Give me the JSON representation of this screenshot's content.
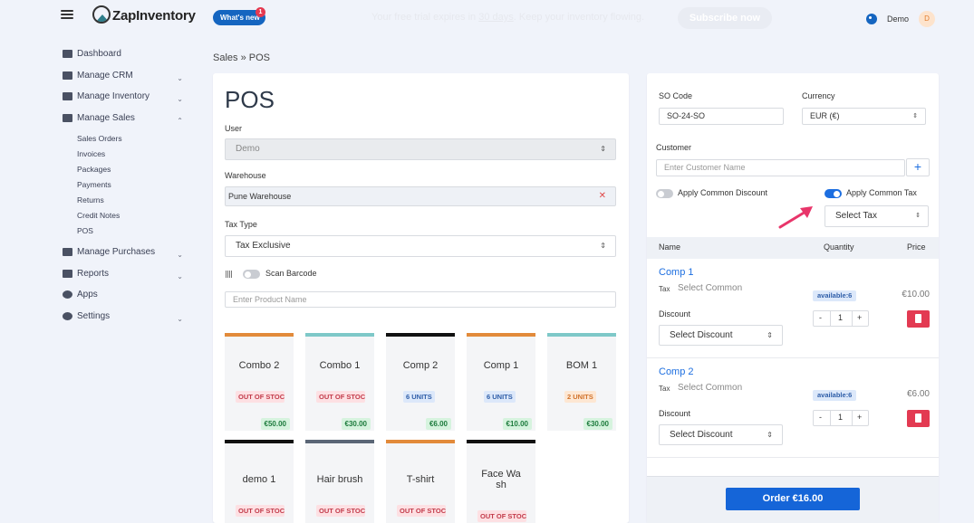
{
  "header": {
    "app_name": "ZapInventory",
    "whats_new": "What's new",
    "whats_new_count": "1",
    "promo_text": "Your free trial expires in",
    "promo_link": "30 days",
    "promo_suffix": ". Keep your inventory flowing.",
    "subscribe_label": "Subscribe now",
    "user_name": "Demo",
    "user_initial": "D"
  },
  "sidebar": {
    "items": [
      {
        "label": "Dashboard",
        "icon": "home-icon"
      },
      {
        "label": "Manage CRM",
        "icon": "users-icon"
      },
      {
        "label": "Manage Inventory",
        "icon": "inventory-icon"
      },
      {
        "label": "Manage Sales",
        "icon": "cart-icon"
      }
    ],
    "sales_sub": [
      "Sales Orders",
      "Invoices",
      "Packages",
      "Payments",
      "Returns",
      "Credit Notes",
      "POS"
    ],
    "items_after": [
      {
        "label": "Manage Purchases",
        "icon": "purchases-icon"
      },
      {
        "label": "Reports",
        "icon": "reports-icon"
      },
      {
        "label": "Apps",
        "icon": "apps-icon"
      },
      {
        "label": "Settings",
        "icon": "gear-icon"
      }
    ]
  },
  "breadcrumb": {
    "parent": "Sales",
    "sep": "»",
    "current": "POS"
  },
  "pos": {
    "title": "POS",
    "user_label": "User",
    "user_value": "Demo",
    "warehouse_label": "Warehouse",
    "warehouse_value": "Pune Warehouse",
    "tax_type_label": "Tax Type",
    "tax_type_value": "Tax Exclusive",
    "scan_label": "Scan Barcode",
    "product_placeholder": "Enter Product Name",
    "products": [
      {
        "name": "Combo 2",
        "stock": "OUT OF STOCK",
        "price": "€50.00",
        "color": "#e28a3a"
      },
      {
        "name": "Combo 1",
        "stock": "OUT OF STOCK",
        "price": "€30.00",
        "color": "#7ec8c8"
      },
      {
        "name": "Comp 2",
        "stock": "6 UNITS",
        "price": "€6.00",
        "color": "#111111"
      },
      {
        "name": "Comp 1",
        "stock": "6 UNITS",
        "price": "€10.00",
        "color": "#e28a3a"
      },
      {
        "name": "BOM 1",
        "stock": "2 UNITS",
        "price": "€30.00",
        "color": "#7ec8c8"
      },
      {
        "name": "demo 1",
        "stock": "OUT OF STOCK",
        "color": "#111111"
      },
      {
        "name": "Hair brush",
        "stock": "OUT OF STOCK",
        "color": "#5a6676"
      },
      {
        "name": "T-shirt",
        "stock": "OUT OF STOCK",
        "color": "#e28a3a"
      },
      {
        "name": "Face Wash",
        "stock": "OUT OF STOCK",
        "color": "#111111"
      }
    ]
  },
  "order": {
    "so_code_label": "SO Code",
    "so_code_value": "SO-24-SO",
    "currency_label": "Currency",
    "currency_value": "EUR (€)",
    "customer_label": "Customer",
    "customer_placeholder": "Enter Customer Name",
    "common_discount_label": "Apply Common Discount",
    "common_tax_label": "Apply Common Tax",
    "select_tax": "Select Tax",
    "col_name": "Name",
    "col_quantity": "Quantity",
    "col_price": "Price",
    "lines": [
      {
        "name": "Comp 1",
        "tax_label": "Tax",
        "tax_value": "Select Common",
        "available": "available:6",
        "price": "€10.00",
        "discount_label": "Discount",
        "discount_value": "Select Discount",
        "qty": "1",
        "minus": "-",
        "plus": "+"
      },
      {
        "name": "Comp 2",
        "tax_label": "Tax",
        "tax_value": "Select Common",
        "available": "available:6",
        "price": "€6.00",
        "discount_label": "Discount",
        "discount_value": "Select Discount",
        "qty": "1",
        "minus": "-",
        "plus": "+"
      }
    ],
    "order_button": "Order €16.00"
  }
}
